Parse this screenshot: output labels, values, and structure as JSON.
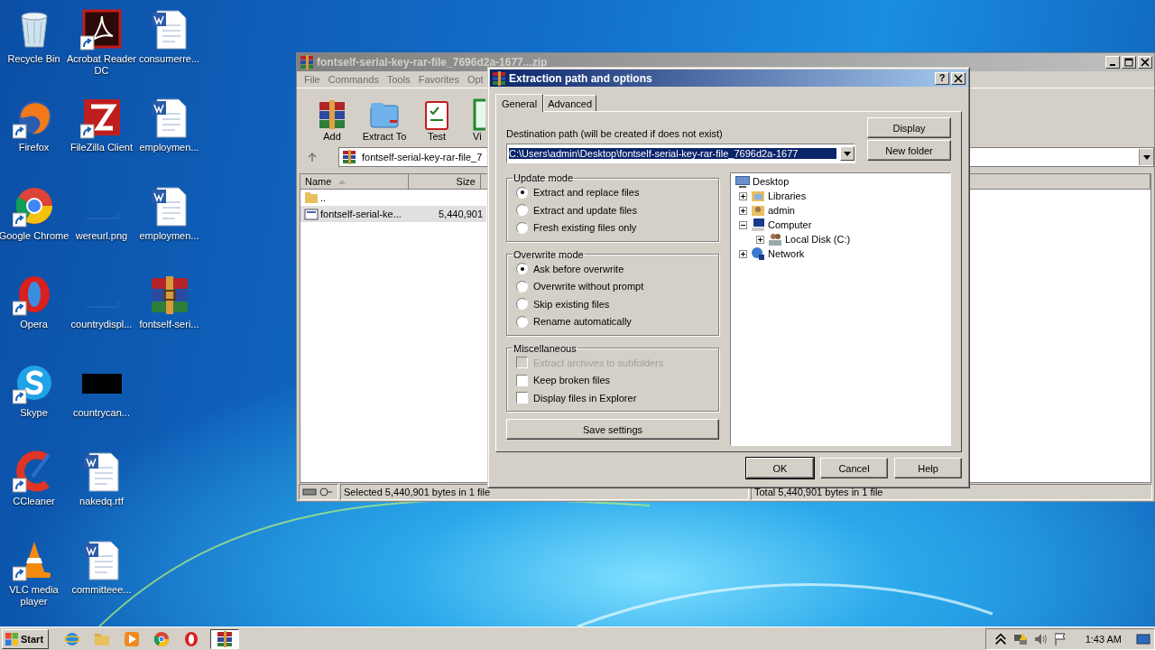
{
  "desktop": {
    "columns": [
      [
        {
          "label": "Recycle Bin",
          "kind": "recycle",
          "shortcut": false
        },
        {
          "label": "Firefox",
          "kind": "firefox",
          "shortcut": true
        },
        {
          "label": "Google Chrome",
          "kind": "chrome",
          "shortcut": true
        },
        {
          "label": "Opera",
          "kind": "opera",
          "shortcut": true
        },
        {
          "label": "Skype",
          "kind": "skype",
          "shortcut": true
        },
        {
          "label": "CCleaner",
          "kind": "ccleaner",
          "shortcut": true
        },
        {
          "label": "VLC media player",
          "kind": "vlc",
          "shortcut": true
        }
      ],
      [
        {
          "label": "Acrobat Reader DC",
          "kind": "acrobat",
          "shortcut": true
        },
        {
          "label": "FileZilla Client",
          "kind": "filezilla",
          "shortcut": true
        },
        {
          "label": "wereurl.png",
          "kind": "blank",
          "shortcut": false
        },
        {
          "label": "countrydispl...",
          "kind": "blank",
          "shortcut": false
        },
        {
          "label": "countrycan...",
          "kind": "black",
          "shortcut": false
        },
        {
          "label": "nakedq.rtf",
          "kind": "word",
          "shortcut": false
        },
        {
          "label": "committeee...",
          "kind": "word",
          "shortcut": false
        }
      ],
      [
        {
          "label": "consumerre...",
          "kind": "word",
          "shortcut": false
        },
        {
          "label": "employmen...",
          "kind": "word",
          "shortcut": false
        },
        {
          "label": "employmen...",
          "kind": "word",
          "shortcut": false
        },
        {
          "label": "fontself-seri...",
          "kind": "winrar",
          "shortcut": false
        }
      ]
    ]
  },
  "archive_window": {
    "title": "fontself-serial-key-rar-file_7696d2a-1677...zip",
    "menu": [
      "File",
      "Commands",
      "Tools",
      "Favorites",
      "Opt"
    ],
    "toolbar": [
      {
        "label": "Add",
        "kind": "add"
      },
      {
        "label": "Extract To",
        "kind": "extract"
      },
      {
        "label": "Test",
        "kind": "test"
      },
      {
        "label": "Vi",
        "kind": "view"
      }
    ],
    "address": "fontself-serial-key-rar-file_7",
    "columns": [
      "Name",
      "Size"
    ],
    "rows": [
      {
        "name": "..",
        "kind": "parent",
        "selected": false
      },
      {
        "name": "fontself-serial-ke...",
        "size": "5,440,901",
        "kind": "file",
        "selected": true
      }
    ],
    "status_left": "Selected 5,440,901 bytes in 1 file",
    "status_right": "Total 5,440,901 bytes in 1 file"
  },
  "dialog": {
    "title": "Extraction path and options",
    "help_glyph": "?",
    "tabs": [
      {
        "label": "General",
        "selected": true
      },
      {
        "label": "Advanced",
        "selected": false
      }
    ],
    "destination_label": "Destination path (will be created if does not exist)",
    "destination_path": "C:\\Users\\admin\\Desktop\\fontself-serial-key-rar-file_7696d2a-1677",
    "side_buttons": [
      "Display",
      "New folder"
    ],
    "groups": [
      {
        "title": "Update mode",
        "kind": "radio",
        "options": [
          {
            "label": "Extract and replace files",
            "selected": true
          },
          {
            "label": "Extract and update files",
            "selected": false
          },
          {
            "label": "Fresh existing files only",
            "selected": false
          }
        ]
      },
      {
        "title": "Overwrite mode",
        "kind": "radio",
        "options": [
          {
            "label": "Ask before overwrite",
            "selected": true
          },
          {
            "label": "Overwrite without prompt",
            "selected": false
          },
          {
            "label": "Skip existing files",
            "selected": false
          },
          {
            "label": "Rename automatically",
            "selected": false
          }
        ]
      },
      {
        "title": "Miscellaneous",
        "kind": "check",
        "options": [
          {
            "label": "Extract archives to subfolders",
            "checked": false,
            "disabled": true
          },
          {
            "label": "Keep broken files",
            "checked": false,
            "disabled": false
          },
          {
            "label": "Display files in Explorer",
            "checked": false,
            "disabled": false
          }
        ]
      }
    ],
    "save_button": "Save settings",
    "tree": {
      "label": "Desktop",
      "kind": "desktop",
      "children": [
        {
          "label": "Libraries",
          "kind": "libraries",
          "expanded": false
        },
        {
          "label": "admin",
          "kind": "user",
          "expanded": false
        },
        {
          "label": "Computer",
          "kind": "computer",
          "expanded": true,
          "children": [
            {
              "label": "Local Disk (C:)",
              "kind": "disk",
              "expanded": false
            }
          ]
        },
        {
          "label": "Network",
          "kind": "network",
          "expanded": false
        }
      ]
    },
    "buttons": [
      "OK",
      "Cancel",
      "Help"
    ]
  },
  "taskbar": {
    "start": "Start",
    "apps": [
      {
        "kind": "ie",
        "active": false
      },
      {
        "kind": "folder",
        "active": false
      },
      {
        "kind": "media",
        "active": false
      },
      {
        "kind": "chrome",
        "active": false
      },
      {
        "kind": "opera",
        "active": false
      },
      {
        "kind": "winrar",
        "active": true
      }
    ],
    "clock": "1:43 AM"
  }
}
